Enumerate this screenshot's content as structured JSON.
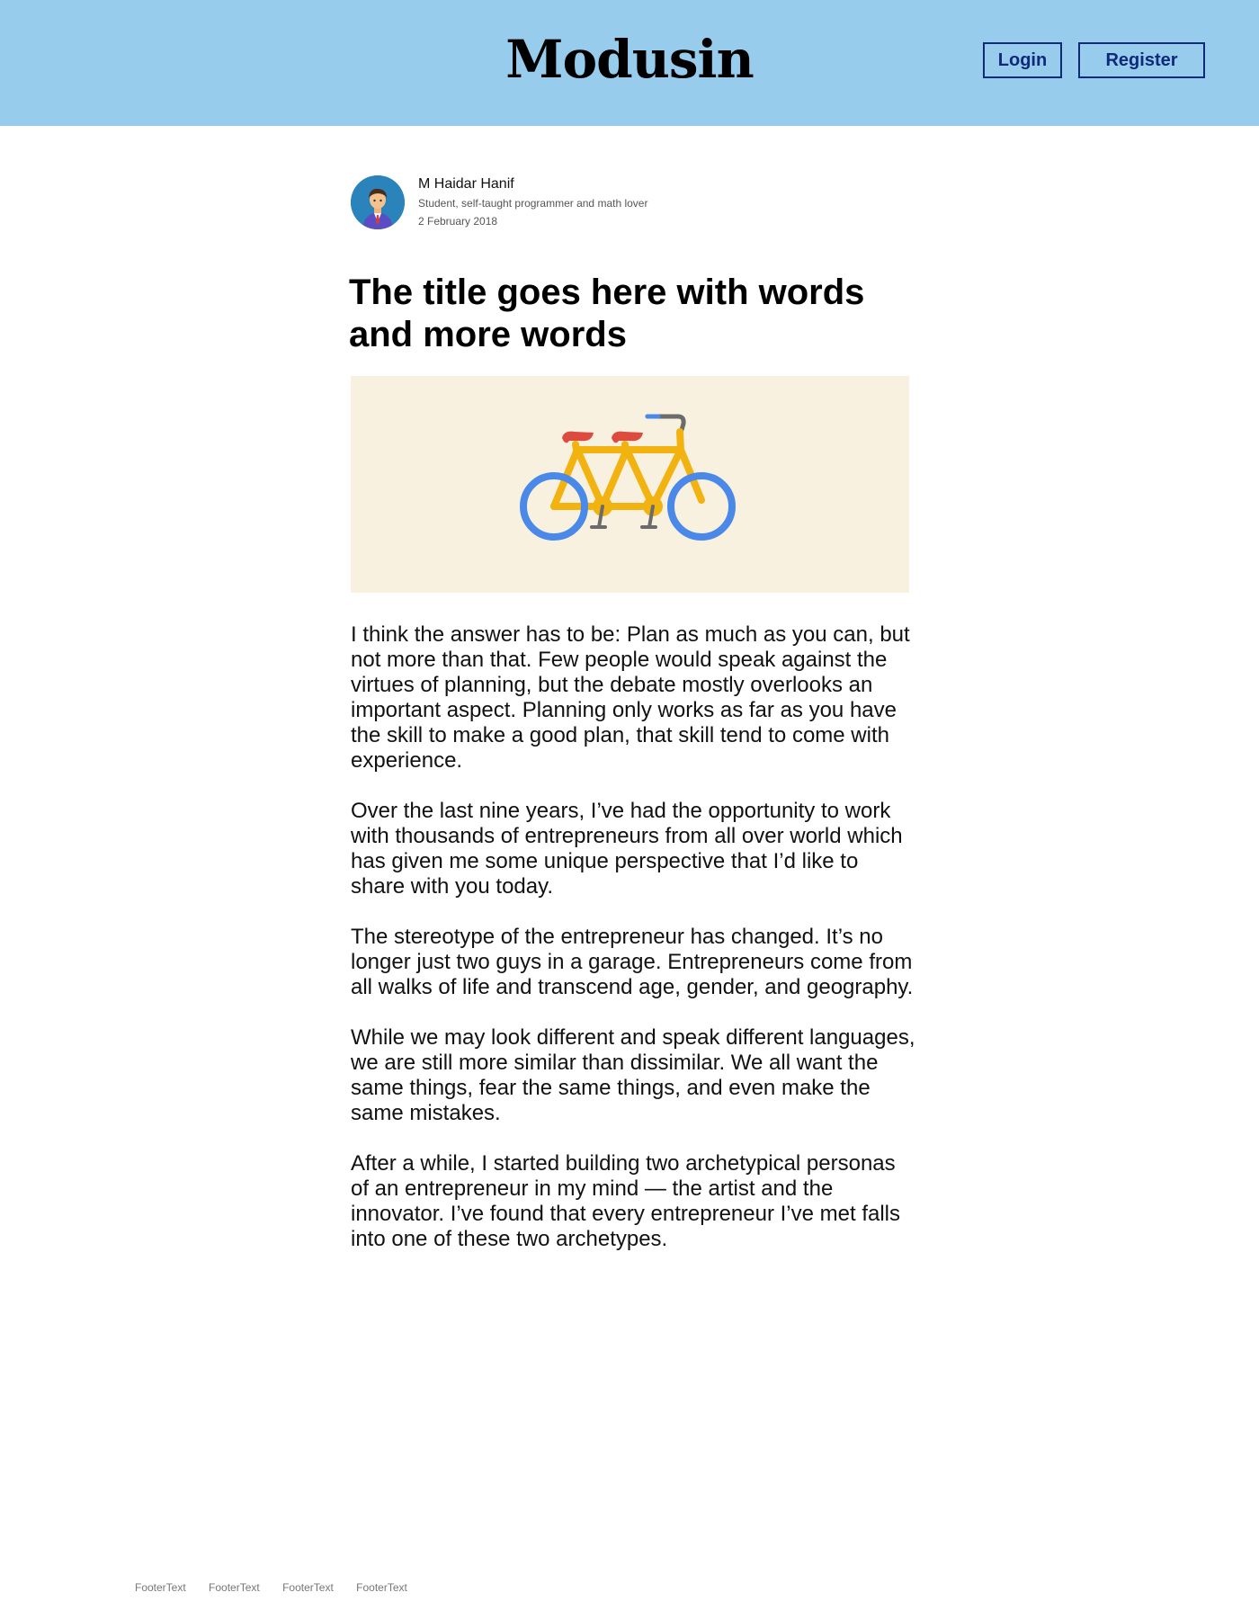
{
  "header": {
    "brand": "Modusin",
    "login_label": "Login",
    "register_label": "Register"
  },
  "author": {
    "name": "M Haidar Hanif",
    "bio": "Student, self-taught programmer and math lover",
    "date": "2 February 2018"
  },
  "article": {
    "title": "The title goes here with words and more words",
    "hero_image": "tandem-bicycle-illustration",
    "paragraphs": [
      "I think the answer has to be: Plan as much as you can, but not more than that. Few people would speak against the virtues of planning, but the debate mostly overlooks an important aspect. Planning only works as far as you have the skill to make a good plan, that skill tend to come with experience.",
      "Over the last nine years, I’ve had the opportunity to work with thousands of entrepreneurs from all over world which has given me some unique perspective that I’d like to share with you today.",
      "The stereotype of the entrepreneur has changed. It’s no longer just two guys in a garage. Entrepreneurs come from all walks of life and transcend age, gender, and geography.",
      "While we may look different and speak different languages, we are still more similar than dissimilar. We all want the same things, fear the same things, and even make the same mistakes.",
      "After a while, I started building two archetypical personas of an entrepreneur in my mind — the artist and the innovator. I’ve found that every entrepreneur I’ve met falls into one of these two archetypes."
    ]
  },
  "footer": {
    "links": [
      "FooterText",
      "FooterText",
      "FooterText",
      "FooterText"
    ]
  },
  "colors": {
    "header_bg": "#97cced",
    "button_border": "#10297a",
    "hero_bg": "#f8f1df",
    "avatar_bg": "#2a83bb",
    "bike_wheels": "#4a89e8",
    "bike_frame": "#f2b311",
    "bike_seats": "#dd4b3e"
  }
}
